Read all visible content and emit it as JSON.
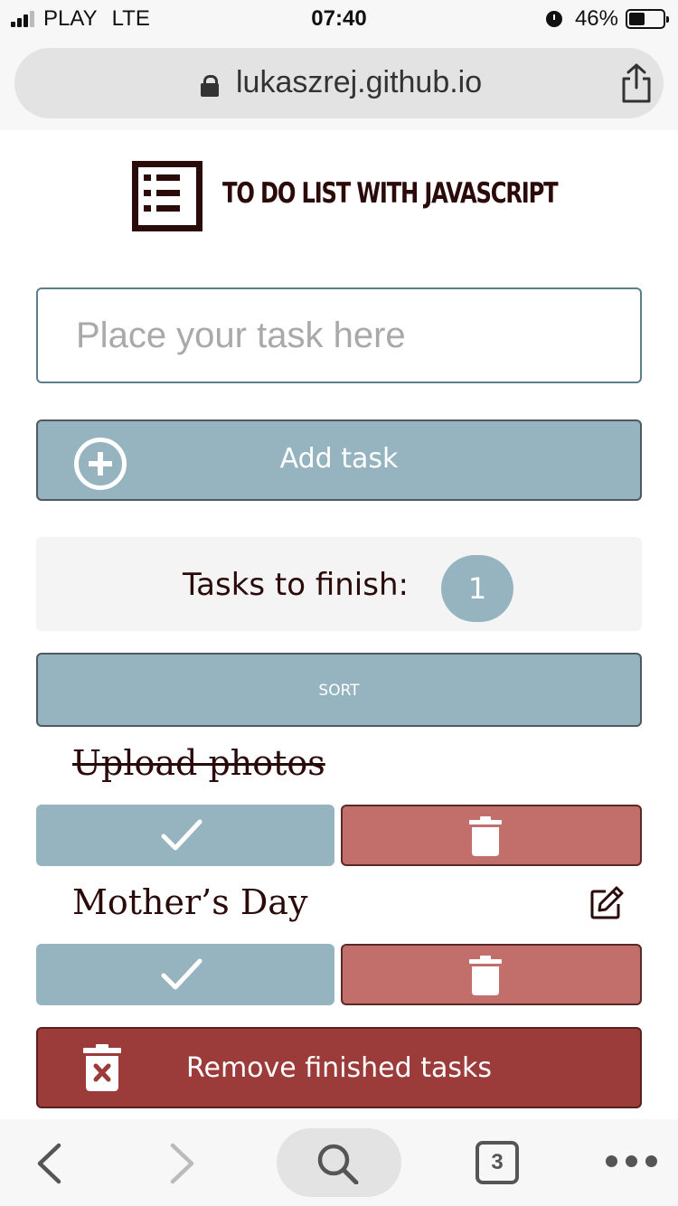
{
  "status_bar": {
    "carrier": "PLAY",
    "network": "LTE",
    "time": "07:40",
    "battery": "46%",
    "battery_level": 0.46
  },
  "browser": {
    "url": "lukaszrej.github.io"
  },
  "app": {
    "title": "TO DO LIST WITH JAVASCRIPT",
    "input_placeholder": "Place your task here",
    "add_label": "Add task",
    "counter_label": "Tasks to finish:",
    "counter_value": "1",
    "sort_label": "SORT",
    "tasks": [
      {
        "title": "Upload photos",
        "done": true
      },
      {
        "title": "Mother’s Day",
        "done": false
      }
    ],
    "remove_label": "Remove finished tasks"
  },
  "toolbar": {
    "tab_count": "3"
  },
  "colors": {
    "accent_blue": "#95b4bf",
    "delete_red": "#c26e6a",
    "remove_red": "#9b3c3a",
    "text_dark": "#2b0a0a"
  }
}
